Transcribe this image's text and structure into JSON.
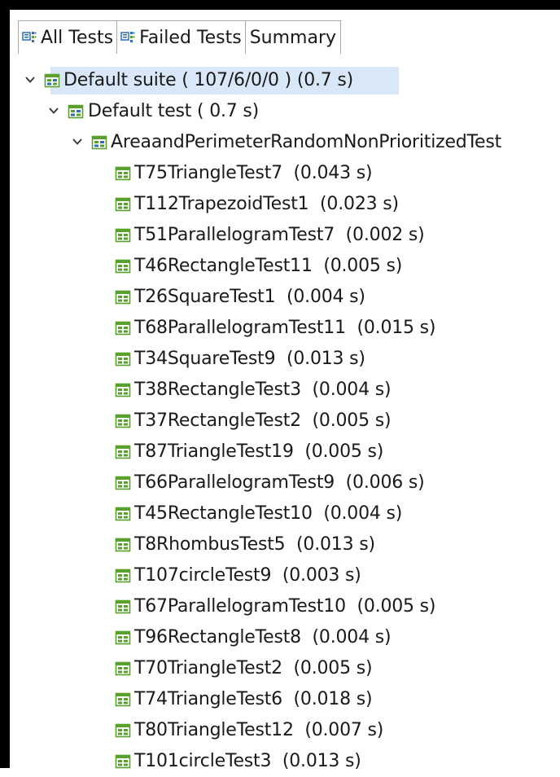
{
  "tabs": [
    {
      "label": "All Tests",
      "icon": "test-hierarchy-icon"
    },
    {
      "label": "Failed Tests",
      "icon": "test-hierarchy-icon"
    },
    {
      "label": "Summary"
    }
  ],
  "tree": {
    "suite": {
      "label": "Default suite ( 107/6/0/0 ) (0.7 s)",
      "icon": "suite-icon",
      "expanded": true,
      "selected": true
    },
    "test": {
      "label": "Default test ( 0.7 s)",
      "icon": "suite-icon",
      "expanded": true
    },
    "class": {
      "label": "AreaandPerimeterRandomNonPrioritizedTest",
      "icon": "suite-icon",
      "expanded": true
    },
    "methods": [
      {
        "label": "T75TriangleTest7  (0.043 s)"
      },
      {
        "label": "T112TrapezoidTest1  (0.023 s)"
      },
      {
        "label": "T51ParallelogramTest7  (0.002 s)"
      },
      {
        "label": "T46RectangleTest11  (0.005 s)"
      },
      {
        "label": "T26SquareTest1  (0.004 s)"
      },
      {
        "label": "T68ParallelogramTest11  (0.015 s)"
      },
      {
        "label": "T34SquareTest9  (0.013 s)"
      },
      {
        "label": "T38RectangleTest3  (0.004 s)"
      },
      {
        "label": "T37RectangleTest2  (0.005 s)"
      },
      {
        "label": "T87TriangleTest19  (0.005 s)"
      },
      {
        "label": "T66ParallelogramTest9  (0.006 s)"
      },
      {
        "label": "T45RectangleTest10  (0.004 s)"
      },
      {
        "label": "T8RhombusTest5  (0.013 s)"
      },
      {
        "label": "T107circleTest9  (0.003 s)"
      },
      {
        "label": "T67ParallelogramTest10  (0.005 s)"
      },
      {
        "label": "T96RectangleTest8  (0.004 s)"
      },
      {
        "label": "T70TriangleTest2  (0.005 s)"
      },
      {
        "label": "T74TriangleTest6  (0.018 s)"
      },
      {
        "label": "T80TriangleTest12  (0.007 s)"
      },
      {
        "label": "T101circleTest3  (0.013 s)"
      }
    ]
  },
  "colors": {
    "selection": "#d9e8f8",
    "icon_green": "#5aa02c",
    "icon_blue": "#2f6db5",
    "border": "#a9a9a9"
  }
}
